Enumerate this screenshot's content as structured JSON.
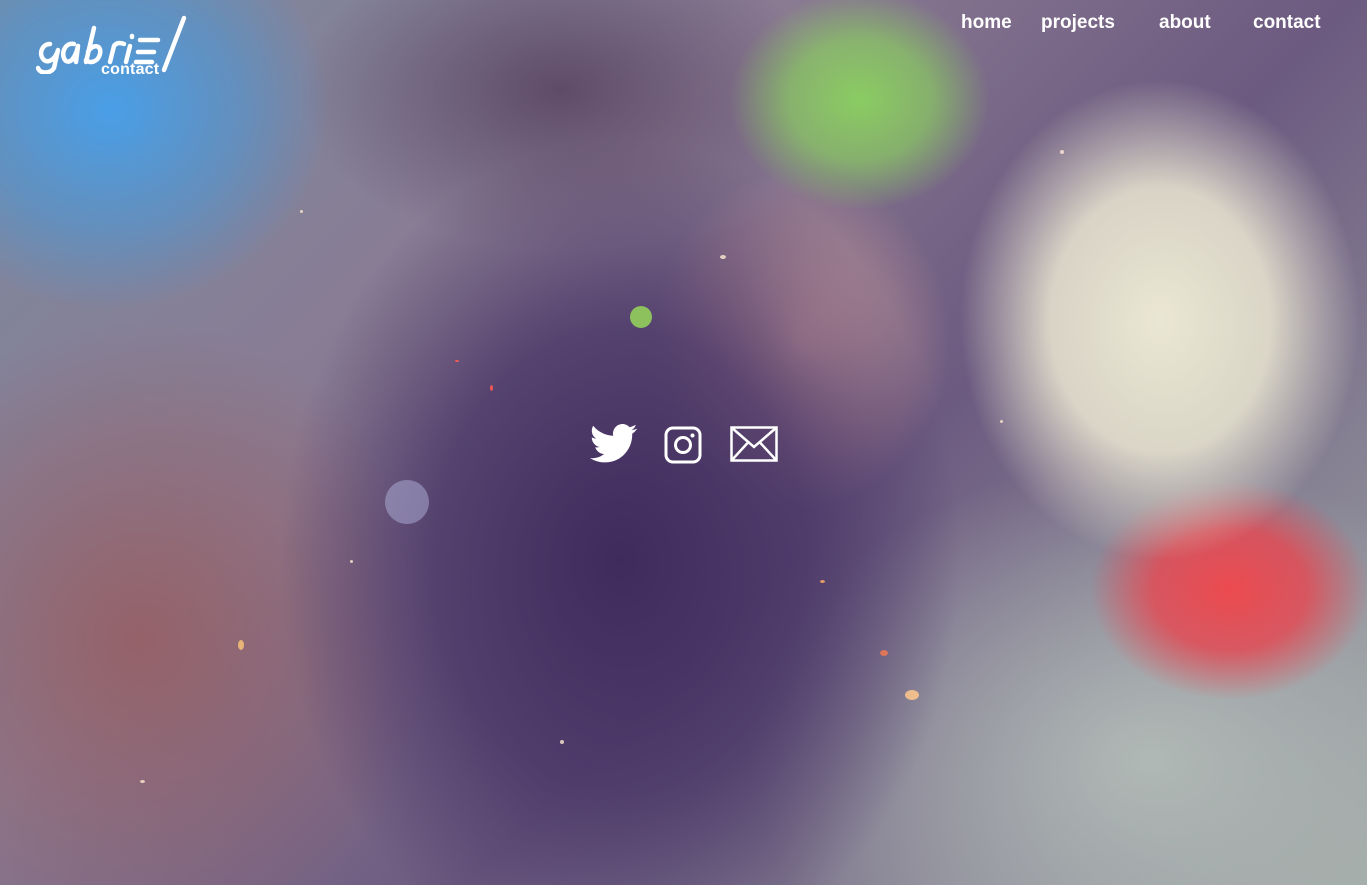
{
  "logo": {
    "wordmark": "gabriel",
    "subtitle": "contact",
    "icon": "gabriel-handwritten-logo"
  },
  "nav": {
    "items": [
      {
        "label": "home"
      },
      {
        "label": "projects"
      },
      {
        "label": "about"
      },
      {
        "label": "contact"
      }
    ]
  },
  "social": {
    "links": [
      {
        "icon": "twitter-icon"
      },
      {
        "icon": "instagram-icon"
      },
      {
        "icon": "mail-icon"
      }
    ]
  },
  "colors": {
    "text": "#ffffff",
    "icon": "#ffffff"
  }
}
